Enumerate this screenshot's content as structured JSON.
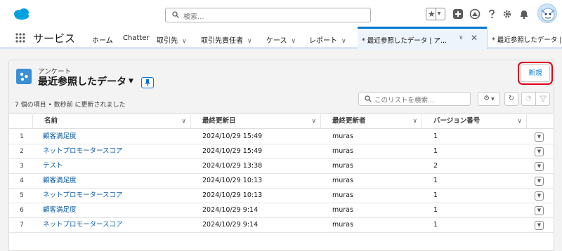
{
  "header": {
    "search_placeholder": "検索...",
    "icons": [
      "salesforce-cloud-logo",
      "favorites-star-icon",
      "add-icon",
      "trailhead-icon",
      "help-icon",
      "setup-gear-icon",
      "notification-bell-icon",
      "avatar"
    ]
  },
  "nav": {
    "app_name": "サービス",
    "items": [
      {
        "label": "ホーム",
        "has_menu": false
      },
      {
        "label": "Chatter",
        "has_menu": false
      },
      {
        "label": "取引先",
        "has_menu": true
      },
      {
        "label": "取引先責任者",
        "has_menu": true
      },
      {
        "label": "ケース",
        "has_menu": true
      },
      {
        "label": "レポート",
        "has_menu": true
      }
    ],
    "tabs": [
      {
        "label": "* 最近参照したデータ | ア...",
        "active": true
      },
      {
        "label": "* 最近参照したデータ | ア",
        "active": false
      }
    ],
    "chevron_glyph": "∨",
    "close_glyph": "✕"
  },
  "list": {
    "object_name": "アンケート",
    "view_name": "最近参照したデータ",
    "status": "7 個の項目 • 数秒前 に更新されました",
    "new_button": "新規",
    "search_placeholder": "このリストを検索...",
    "columns": [
      "名前",
      "最終更新日",
      "最終更新者",
      "バージョン番号"
    ],
    "rows": [
      {
        "num": "1",
        "name": "顧客満足度",
        "modified": "2024/10/29 15:49",
        "modified_by": "muras",
        "version": "1"
      },
      {
        "num": "2",
        "name": "ネットプロモータースコア",
        "modified": "2024/10/29 15:49",
        "modified_by": "muras",
        "version": "1"
      },
      {
        "num": "3",
        "name": "テスト",
        "modified": "2024/10/29 13:38",
        "modified_by": "muras",
        "version": "2"
      },
      {
        "num": "4",
        "name": "顧客満足度",
        "modified": "2024/10/29 10:13",
        "modified_by": "muras",
        "version": "1"
      },
      {
        "num": "5",
        "name": "ネットプロモータースコア",
        "modified": "2024/10/29 10:13",
        "modified_by": "muras",
        "version": "1"
      },
      {
        "num": "6",
        "name": "顧客満足度",
        "modified": "2024/10/29 9:14",
        "modified_by": "muras",
        "version": "1"
      },
      {
        "num": "7",
        "name": "ネットプロモータースコア",
        "modified": "2024/10/29 9:14",
        "modified_by": "muras",
        "version": "1"
      }
    ]
  },
  "colors": {
    "brand": "#00a1e0",
    "link": "#0b5cab",
    "active_tab": "#0176d3",
    "highlight_box": "#e3001b"
  }
}
